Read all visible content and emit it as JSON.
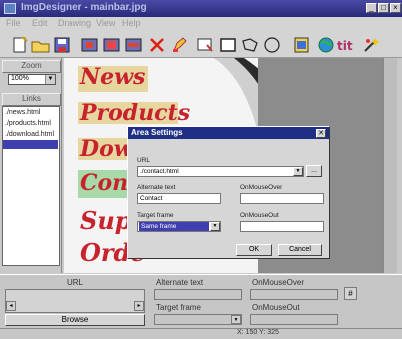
{
  "window": {
    "title": "ImgDesigner - mainbar.jpg",
    "btn_min": "_",
    "btn_max": "□",
    "btn_close": "×"
  },
  "menu": [
    "File",
    "Edit",
    "Drawing",
    "View",
    "Help"
  ],
  "toolbar_icons": [
    "new-icon",
    "open-icon",
    "save-icon",
    "copy-area-icon",
    "paste-area-icon",
    "duplicate-icon",
    "delete-icon",
    "edit-icon",
    "select-icon",
    "rectangle-icon",
    "polygon-icon",
    "circle-icon",
    "mask-icon",
    "preview-icon",
    "html-icon",
    "wizard-icon"
  ],
  "left": {
    "zoom_header": "Zoom",
    "zoom_value": "100%",
    "links_header": "Links",
    "links": [
      "./news.html",
      "./products.html",
      "./download.html"
    ]
  },
  "canvas": {
    "words": [
      "News",
      "Products",
      "Down",
      "Conta",
      "Suppo",
      "Orde"
    ]
  },
  "dialog": {
    "title": "Area Settings",
    "url_label": "URL",
    "url_value": "./contact.html",
    "browse_label": "...",
    "alt_label": "Alternate text",
    "alt_value": "Contact",
    "mouseover_label": "OnMouseOver",
    "mouseover_value": "",
    "target_label": "Target frame",
    "target_value": "Same frame",
    "mouseout_label": "OnMouseOut",
    "mouseout_value": "",
    "ok_label": "OK",
    "cancel_label": "Cancel"
  },
  "bottom": {
    "url_label": "URL",
    "browse_label": "Browse",
    "alt_label": "Alternate text",
    "target_label": "Target frame",
    "mouseover_label": "OnMouseOver",
    "mouseout_label": "OnMouseOut"
  },
  "status": {
    "coords": "X: 150  Y: 325"
  }
}
